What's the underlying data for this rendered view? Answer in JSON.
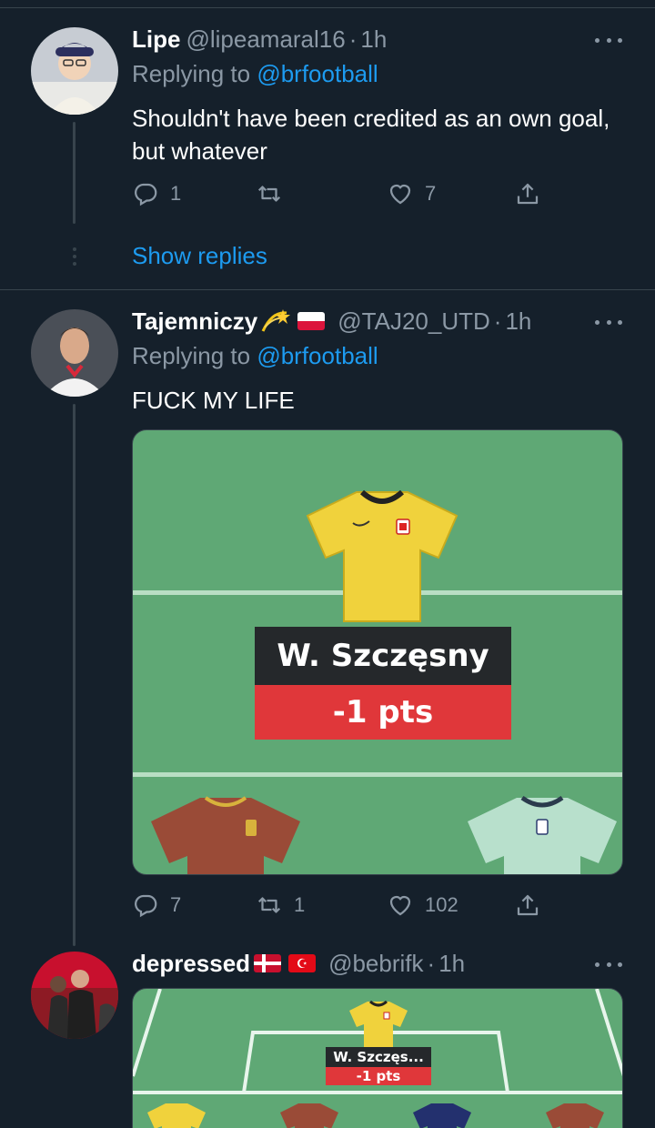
{
  "tweets": [
    {
      "name": "Lipe",
      "handle": "@lipeamaral16",
      "dot": "·",
      "time": "1h",
      "replying_prefix": "Replying to ",
      "replying_to": "@brfootball",
      "text": "Shouldn't have been credited as  an own goal, but whatever",
      "reply_count": "1",
      "retweet_count": "",
      "like_count": "7",
      "show_replies": "Show replies"
    },
    {
      "name": "Tajemniczy",
      "handle": "@TAJ20_UTD",
      "dot": "·",
      "time": "1h",
      "replying_prefix": "Replying to ",
      "replying_to": "@brfootball",
      "text": "FUCK MY LIFE",
      "reply_count": "7",
      "retweet_count": "1",
      "like_count": "102",
      "media": {
        "player_name": "W. Szczęsny",
        "points": "-1 pts"
      }
    },
    {
      "name": "depressed",
      "handle": "@bebrifk",
      "dot": "·",
      "time": "1h",
      "media": {
        "player_name": "W. Szczęs...",
        "points": "-1 pts"
      }
    }
  ],
  "colors": {
    "background": "#15202b",
    "accent": "#1d9bf0",
    "secondary_text": "#8b98a5",
    "divider": "#38444d",
    "pitch": "#5fa875",
    "points_red": "#e0373a"
  },
  "icons": [
    "reply-icon",
    "retweet-icon",
    "like-icon",
    "share-icon",
    "more-icon"
  ]
}
